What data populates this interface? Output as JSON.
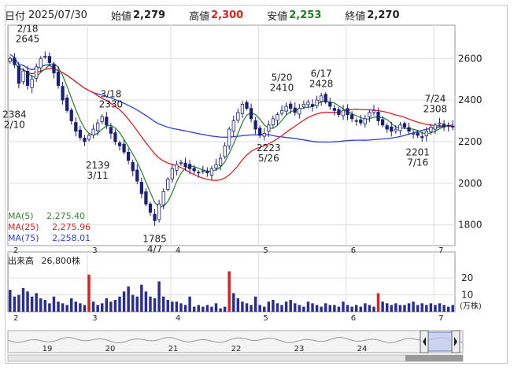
{
  "header": {
    "date_label": "日付",
    "date": "2025/07/30",
    "open_label": "始値",
    "open": "2,279",
    "high_label": "高値",
    "high": "2,300",
    "low_label": "安値",
    "low": "2,253",
    "close_label": "終値",
    "close": "2,270"
  },
  "colors": {
    "up": "#ffffff",
    "down": "#1a1f7a",
    "ma5": "#2e8b2e",
    "ma25": "#e02020",
    "ma75": "#2b3fd6",
    "high_value": "#e02020",
    "low_value": "#1f7f1f",
    "volume": "#2a2f8f",
    "volume_highlight": "#e02020"
  },
  "ma_legend": [
    {
      "label": "MA(5)",
      "value": "2,275.40",
      "color": "#2e8b2e"
    },
    {
      "label": "MA(25)",
      "value": "2,275.96",
      "color": "#e02020"
    },
    {
      "label": "MA(75)",
      "value": "2,258.01",
      "color": "#2b3fd6"
    }
  ],
  "volume_label": "出来高",
  "volume_value": "26,800株",
  "volume_unit": "(万株)",
  "navigator_labels": [
    "19",
    "20",
    "21",
    "22",
    "23",
    "24"
  ],
  "chart_data": {
    "type": "candlestick",
    "y_ticks": [
      1800,
      2000,
      2200,
      2400,
      2600
    ],
    "ylim": [
      1700,
      2760
    ],
    "month_labels": [
      {
        "label": "2",
        "index": 0
      },
      {
        "label": "3",
        "index": 18
      },
      {
        "label": "4",
        "index": 37
      },
      {
        "label": "5",
        "index": 57
      },
      {
        "label": "6",
        "index": 77
      },
      {
        "label": "7",
        "index": 97
      }
    ],
    "annotations": [
      {
        "date": "2/18",
        "value": "2645",
        "pos": "above"
      },
      {
        "date": "2/10",
        "value": "2384",
        "pos": "below"
      },
      {
        "date": "3/18",
        "value": "2330",
        "pos": "above"
      },
      {
        "date": "3/11",
        "value": "2139",
        "pos": "below"
      },
      {
        "date": "4/7",
        "value": "1785",
        "pos": "below"
      },
      {
        "date": "5/20",
        "value": "2410",
        "pos": "above"
      },
      {
        "date": "5/26",
        "value": "2223",
        "pos": "below"
      },
      {
        "date": "6/17",
        "value": "2428",
        "pos": "above"
      },
      {
        "date": "7/16",
        "value": "2201",
        "pos": "below"
      },
      {
        "date": "7/24",
        "value": "2308",
        "pos": "above"
      }
    ],
    "close": [
      2600,
      2570,
      2480,
      2540,
      2470,
      2500,
      2560,
      2600,
      2610,
      2580,
      2530,
      2470,
      2400,
      2350,
      2300,
      2250,
      2220,
      2200,
      2230,
      2260,
      2290,
      2320,
      2280,
      2240,
      2200,
      2180,
      2150,
      2110,
      2060,
      2010,
      1950,
      1900,
      1860,
      1820,
      1900,
      1960,
      2020,
      2070,
      2090,
      2100,
      2080,
      2070,
      2060,
      2050,
      2060,
      2050,
      2070,
      2090,
      2120,
      2180,
      2260,
      2300,
      2340,
      2380,
      2360,
      2310,
      2260,
      2230,
      2240,
      2280,
      2310,
      2330,
      2350,
      2370,
      2360,
      2340,
      2360,
      2380,
      2390,
      2370,
      2400,
      2420,
      2390,
      2370,
      2350,
      2330,
      2350,
      2330,
      2310,
      2300,
      2290,
      2310,
      2340,
      2350,
      2300,
      2280,
      2260,
      2250,
      2260,
      2280,
      2270,
      2250,
      2240,
      2230,
      2220,
      2250,
      2270,
      2280,
      2290,
      2270,
      2275,
      2270
    ],
    "volume": [
      13,
      9,
      10,
      14,
      12,
      9,
      11,
      8,
      7,
      5,
      9,
      6,
      5,
      4,
      8,
      6,
      5,
      4,
      22,
      6,
      4,
      5,
      8,
      6,
      7,
      9,
      12,
      15,
      10,
      9,
      16,
      12,
      9,
      8,
      18,
      9,
      7,
      6,
      6,
      5,
      4,
      9,
      3,
      4,
      3,
      4,
      3,
      5,
      2,
      3,
      24,
      11,
      8,
      6,
      5,
      4,
      9,
      4,
      3,
      6,
      7,
      5,
      4,
      6,
      7,
      5,
      4,
      3,
      6,
      5,
      4,
      3,
      5,
      4,
      4,
      3,
      6,
      4,
      3,
      4,
      3,
      5,
      4,
      3,
      11,
      6,
      5,
      4,
      5,
      4,
      4,
      5,
      6,
      4,
      5,
      4,
      5,
      4,
      5,
      4,
      3,
      4
    ],
    "volume_highlight_index": [
      18,
      50,
      84
    ],
    "volume_ylim": [
      0,
      28
    ],
    "volume_ticks": [
      10,
      20
    ],
    "ma5_last": 2275.4,
    "ma25_last": 2275.96,
    "ma75_last": 2258.01
  }
}
